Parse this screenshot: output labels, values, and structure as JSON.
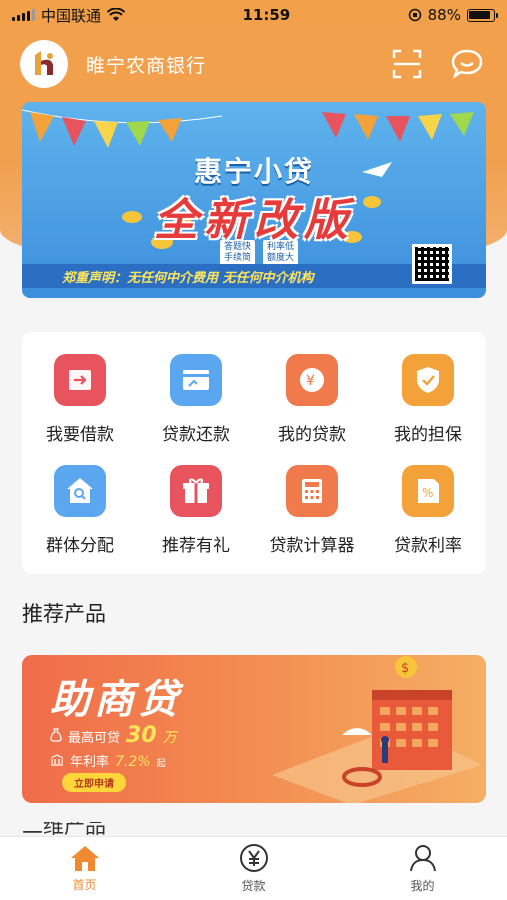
{
  "status_bar": {
    "carrier": "中国联通",
    "time": "11:59",
    "battery": "88%",
    "battery_level": 0.88
  },
  "header": {
    "bank_name": "睢宁农商银行",
    "logo_icon": "bank-logo-icon",
    "scan_icon": "scan-icon",
    "message_icon": "chat-bubble-icon"
  },
  "banner": {
    "title": "惠宁小贷",
    "headline": "全新改版",
    "tags": [
      "答题快\n手续简",
      "利率低\n额度大"
    ],
    "notice": "郑重声明：无任何中介费用  无任何中介机构"
  },
  "menu": {
    "items": [
      {
        "label": "我要借款",
        "icon": "borrow-icon",
        "color": "#e8545d"
      },
      {
        "label": "贷款还款",
        "icon": "repay-card-icon",
        "color": "#5aa7f0"
      },
      {
        "label": "我的贷款",
        "icon": "yen-coin-icon",
        "color": "#f07a4c"
      },
      {
        "label": "我的担保",
        "icon": "shield-check-icon",
        "color": "#f3a23a"
      },
      {
        "label": "群体分配",
        "icon": "home-search-icon",
        "color": "#5aa7f0"
      },
      {
        "label": "推荐有礼",
        "icon": "gift-icon",
        "color": "#e8545d"
      },
      {
        "label": "贷款计算器",
        "icon": "calculator-icon",
        "color": "#f07a4c"
      },
      {
        "label": "贷款利率",
        "icon": "percent-icon",
        "color": "#f3a23a"
      }
    ]
  },
  "recommend": {
    "section_title": "推荐产品",
    "product_name": "助商贷",
    "max_label": "最高可贷",
    "max_value": "30",
    "max_unit": "万",
    "rate_label": "年利率",
    "rate_value": "7.2%",
    "rate_suffix": "起",
    "apply_label": "立即申请"
  },
  "next_section": {
    "title": "二维产品"
  },
  "tabbar": {
    "tabs": [
      {
        "label": "首页",
        "icon": "home-icon",
        "active": true
      },
      {
        "label": "贷款",
        "icon": "yen-circle-icon",
        "active": false
      },
      {
        "label": "我的",
        "icon": "user-icon",
        "active": false
      }
    ]
  },
  "colors": {
    "brand_orange": "#f0a14f",
    "active_tab": "#f0892f"
  }
}
